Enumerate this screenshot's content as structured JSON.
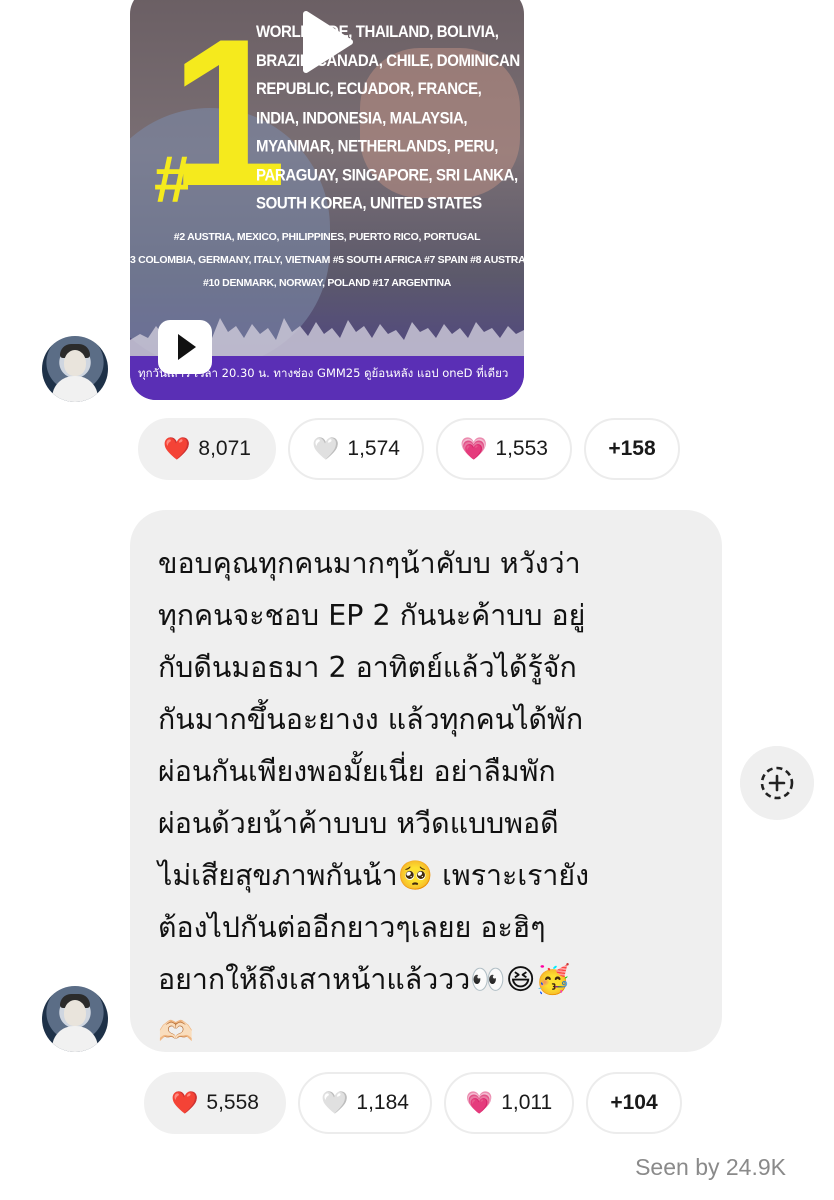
{
  "post1": {
    "video": {
      "big_number": "1",
      "hash": "#",
      "countries": "WORLDWIDE, THAILAND, BOLIVIA, BRAZIL, CANADA, CHILE, DOMINICAN REPUBLIC, ECUADOR, FRANCE, INDIA, INDONESIA, MALAYSIA, MYANMAR, NETHERLANDS, PERU, PARAGUAY, SINGAPORE, SRI LANKA, SOUTH KOREA, UNITED STATES",
      "rank_line1": "#2 AUSTRIA, MEXICO, PHILIPPINES, PUERTO RICO, PORTUGAL",
      "rank_line2": "3 COLOMBIA, GERMANY, ITALY, VIETNAM #5 SOUTH AFRICA #7 SPAIN #8 AUSTRAL",
      "rank_line3": "#10 DENMARK, NORWAY, POLAND #17 ARGENTINA",
      "footer": "ทุกวันเสาร์ เวลา 20.30 น. ทางช่อง GMM25 ดูย้อนหลัง แอป oneD ที่เดียว"
    },
    "reactions": [
      {
        "emoji": "❤️",
        "count": "8,071",
        "active": true
      },
      {
        "emoji": "🤍",
        "count": "1,574",
        "active": false
      },
      {
        "emoji": "💗",
        "count": "1,553",
        "active": false
      },
      {
        "emoji": "",
        "count": "+158",
        "active": false
      }
    ]
  },
  "post2": {
    "message": "ขอบคุณทุกคนมากๆน้าคับบ หวังว่า\nทุกคนจะชอบ EP 2 กันนะค้าบบ อยู่\nกับดีนมอธมา 2 อาทิตย์แล้วได้รู้จัก\nกันมากขึ้นอะยางง แล้วทุกคนได้พัก\nผ่อนกันเพียงพอมั้ยเนี่ย อย่าลืมพัก\nผ่อนด้วยน้าค้าบบบ หวีดแบบพอดี\nไม่เสียสุขภาพกันน้า🥺 เพราะเรายัง\nต้องไปกันต่ออีกยาวๆเลยย อะฮิๆ\nอยากให้ถึงเสาหน้าแล้ววว👀😆🥳\n🫶🏻",
    "reactions": [
      {
        "emoji": "❤️",
        "count": "5,558",
        "active": true
      },
      {
        "emoji": "🤍",
        "count": "1,184",
        "active": false
      },
      {
        "emoji": "💗",
        "count": "1,011",
        "active": false
      },
      {
        "emoji": "",
        "count": "+104",
        "active": false
      }
    ]
  },
  "seen_by": "Seen by 24.9K",
  "colors": {
    "accent_yellow": "#f5ea1d",
    "bubble_bg": "#efefef",
    "footer_purple": "#5a2fb5"
  }
}
